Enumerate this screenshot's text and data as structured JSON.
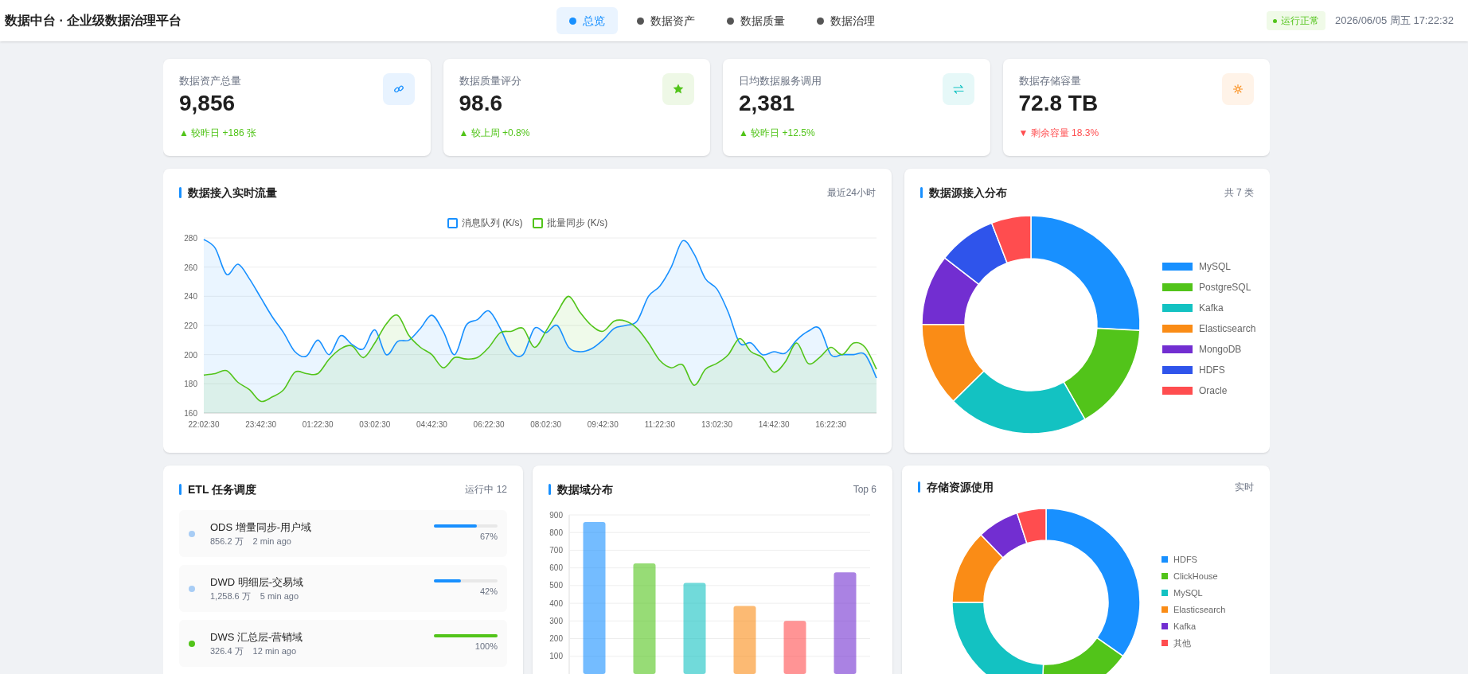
{
  "header": {
    "title": "数据中台 · 企业级数据治理平台",
    "nav": [
      {
        "label": "总览",
        "selected": true
      },
      {
        "label": "数据资产",
        "selected": false
      },
      {
        "label": "数据质量",
        "selected": false
      },
      {
        "label": "数据治理",
        "selected": false
      }
    ],
    "status_badge": "运行正常",
    "datetime": "2026/06/05 周五 17:22:32"
  },
  "stats": [
    {
      "kind": "assets",
      "label": "数据资产总量",
      "value": "9,856",
      "change": "▲ 较昨日 +186 张",
      "positive": true
    },
    {
      "kind": "quality",
      "label": "数据质量评分",
      "value": "98.6",
      "change": "▲ 较上周 +0.8%",
      "positive": true
    },
    {
      "kind": "calls",
      "label": "日均数据服务调用",
      "value": "2,381",
      "change": "▲ 较昨日 +12.5%",
      "positive": true
    },
    {
      "kind": "storage",
      "label": "数据存储容量",
      "value": "72.8 TB",
      "change": "▼ 剩余容量 18.3%",
      "positive": false
    }
  ],
  "traffic": {
    "title": "数据接入实时流量",
    "note": "最近24小时",
    "chart_data": {
      "type": "area",
      "grid": true,
      "categories": [
        "22:02:30",
        null,
        null,
        null,
        null,
        "23:42:30",
        null,
        null,
        null,
        null,
        "01:22:30",
        null,
        null,
        null,
        null,
        "03:02:30",
        null,
        null,
        null,
        null,
        "04:42:30",
        null,
        null,
        null,
        null,
        "06:22:30",
        null,
        null,
        null,
        null,
        "08:02:30",
        null,
        null,
        null,
        null,
        "09:42:30",
        null,
        null,
        null,
        null,
        "11:22:30",
        null,
        null,
        null,
        null,
        "13:02:30",
        null,
        null,
        null,
        null,
        "14:42:30",
        null,
        null,
        null,
        null,
        "16:22:30",
        null,
        null,
        null,
        null
      ],
      "series": [
        {
          "name": "消息队列 (K/s)",
          "color": "#1890ff",
          "values": [
            279,
            273,
            255,
            262,
            252,
            239,
            226,
            215,
            202,
            199,
            210,
            200,
            213,
            207,
            204,
            217,
            200,
            209,
            210,
            218,
            227,
            216,
            200,
            220,
            224,
            230,
            218,
            202,
            200,
            218,
            215,
            220,
            205,
            202,
            204,
            210,
            218,
            220,
            223,
            240,
            247,
            260,
            278,
            269,
            252,
            245,
            229,
            208,
            208,
            200,
            202,
            201,
            210,
            216,
            218,
            200,
            200,
            200,
            200,
            184
          ]
        },
        {
          "name": "批量同步 (K/s)",
          "color": "#52c41a",
          "values": [
            186,
            187,
            189,
            181,
            176,
            168,
            171,
            176,
            188,
            187,
            187,
            197,
            204,
            206,
            198,
            208,
            221,
            227,
            213,
            205,
            200,
            191,
            198,
            197,
            198,
            205,
            215,
            216,
            218,
            205,
            216,
            229,
            240,
            229,
            220,
            216,
            223,
            223,
            218,
            208,
            196,
            191,
            193,
            179,
            190,
            194,
            200,
            211,
            202,
            198,
            188,
            195,
            208,
            194,
            198,
            205,
            200,
            208,
            205,
            190
          ]
        }
      ],
      "ylim": [
        160,
        280
      ],
      "yticks": [
        160,
        180,
        200,
        220,
        240,
        260,
        280
      ]
    }
  },
  "sources": {
    "title": "数据源接入分布",
    "note": "共 7 类",
    "legend": [
      {
        "name": "MySQL",
        "color": "#1890ff"
      },
      {
        "name": "PostgreSQL",
        "color": "#52c41a"
      },
      {
        "name": "Kafka",
        "color": "#13c2c2"
      },
      {
        "name": "Elasticsearch",
        "color": "#fa8c16"
      },
      {
        "name": "MongoDB",
        "color": "#722ed1"
      },
      {
        "name": "HDFS",
        "color": "#2f54eb"
      },
      {
        "name": "Oracle",
        "color": "#ff4d4f"
      }
    ]
  },
  "etl": {
    "title": "ETL 任务调度",
    "note": "运行中 12",
    "tasks": [
      {
        "kind": "running",
        "name": "ODS 增量同步-用户域",
        "volume": "856.2 万",
        "time": "2 min ago",
        "level": 0.67,
        "percent": "67%"
      },
      {
        "kind": "running",
        "name": "DWD 明细层-交易域",
        "volume": "1,258.6 万",
        "time": "5 min ago",
        "level": 0.42,
        "percent": "42%"
      },
      {
        "kind": "done",
        "name": "DWS 汇总层-营销域",
        "volume": "326.4 万",
        "time": "12 min ago",
        "level": 1,
        "percent": "100%"
      }
    ]
  },
  "domains": {
    "title": "数据域分布",
    "note": "Top 6",
    "chart_data": {
      "type": "bar",
      "grid": true,
      "ylim": [
        0,
        900
      ],
      "yticks": [
        100,
        200,
        300,
        400,
        500,
        600,
        700,
        800,
        900
      ],
      "series": [
        {
          "values": [
            860,
            625,
            515,
            385,
            300,
            575
          ],
          "colors": [
            "#1890ff",
            "#52c41a",
            "#13c2c2",
            "#fa8c16",
            "#ff4d4f",
            "#722ed1"
          ]
        }
      ]
    }
  },
  "storage": {
    "title": "存储资源使用",
    "note": "实时",
    "legend": [
      {
        "name": "HDFS",
        "color": "#1890ff"
      },
      {
        "name": "ClickHouse",
        "color": "#52c41a"
      },
      {
        "name": "MySQL",
        "color": "#13c2c2"
      },
      {
        "name": "Elasticsearch",
        "color": "#fa8c16"
      },
      {
        "name": "Kafka",
        "color": "#722ed1"
      },
      {
        "name": "其他",
        "color": "#ff4d4f"
      }
    ]
  }
}
